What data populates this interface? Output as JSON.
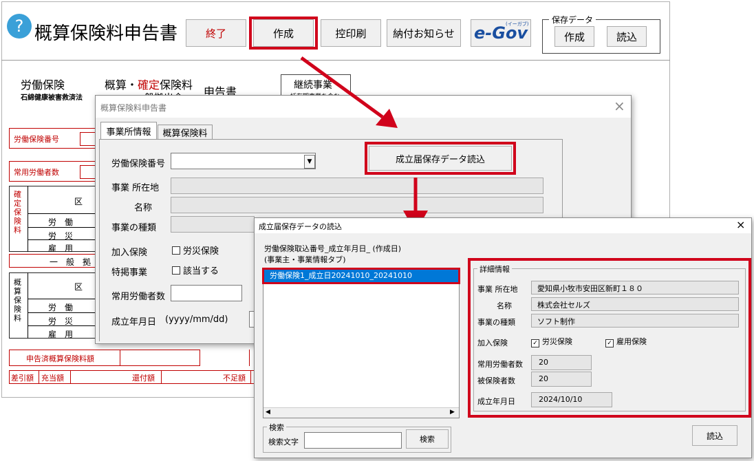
{
  "main": {
    "title": "概算保険料申告書",
    "help_icon": "?",
    "buttons": {
      "end": "終了",
      "create": "作成",
      "copy_print": "控印刷",
      "payment_notice": "納付お知らせ"
    },
    "egov_logo": "e-Gov",
    "egov_kana": "(イーガブ)",
    "save_data": {
      "legend": "保存データ",
      "create": "作成",
      "load": "読込"
    }
  },
  "form": {
    "labor_insurance": "労働保険",
    "asbestos": "石綿健康被害救済法",
    "title_a": "概算・",
    "title_b": "確定",
    "title_c": "保険料",
    "title_d": "一般拠出金",
    "report": "申告書",
    "continuing": "継続事業",
    "continuing_sub": "一括有期事業を含む",
    "labels": {
      "insurance_no": "労働保険番号",
      "regular_workers": "常用労働者数",
      "kakutei_col": "確定保険料",
      "gaisan_col": "概算保険料",
      "ku": "区",
      "rows": [
        "労　働",
        "労　災",
        "雇　用"
      ],
      "general": "一　般　拠",
      "declared_amount": "申告済概算保険料額",
      "diff": "差引額",
      "appropriation": "充当額",
      "refund": "還付額",
      "shortage": "不足額"
    }
  },
  "dialog1": {
    "title": "概算保険料申告書",
    "tabs": [
      "事業所情報",
      "概算保険料"
    ],
    "load_button": "成立届保存データ読込",
    "labels": {
      "insurance_no": "労働保険番号",
      "address": "事業 所在地",
      "name": "名称",
      "business_type": "事業の種類",
      "insurance_join": "加入保険",
      "rousai": "労災保険",
      "special": "特掲事業",
      "applicable": "該当する",
      "regular_workers": "常用労働者数",
      "est_date": "成立年月日",
      "date_format": "(yyyy/mm/dd)"
    },
    "dropdown_arrow": "▼"
  },
  "dialog2": {
    "title": "成立届保存データの読込",
    "list_header1": "労働保険取込番号_成立年月日_ (作成日)",
    "list_header2": "(事業主・事業情報タブ)",
    "list_items": [
      "労働保険1_成立日20241010_20241010"
    ],
    "details": {
      "legend": "詳細情報",
      "address_label": "事業 所在地",
      "address": "愛知県小牧市安田区新町１８０",
      "name_label": "名称",
      "name": "株式会社セルズ",
      "type_label": "事業の種類",
      "type": "ソフト制作",
      "join_label": "加入保険",
      "rousai": "労災保険",
      "koyou": "雇用保険",
      "workers_label": "常用労働者数",
      "workers": "20",
      "insured_label": "被保険者数",
      "insured": "20",
      "date_label": "成立年月日",
      "date": "2024/10/10"
    },
    "search": {
      "legend": "検索",
      "label": "検索文字",
      "button": "検索"
    },
    "load_button": "読込",
    "close": "×"
  },
  "colors": {
    "highlight": "#d0021b",
    "selection": "#0078d7"
  }
}
